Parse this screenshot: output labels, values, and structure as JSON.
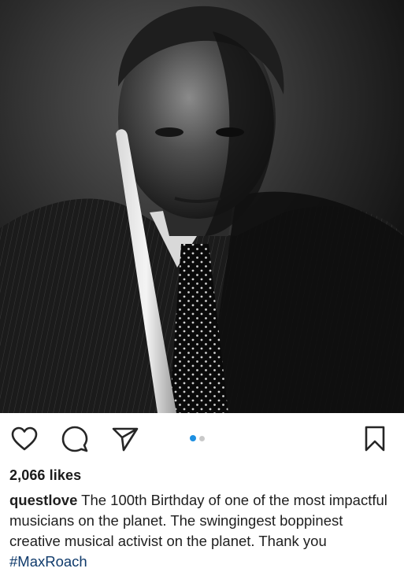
{
  "post": {
    "image_alt": "Black-and-white portrait photograph of a man in a pinstripe suit and polka-dot tie holding a drumstick vertically",
    "likes_text": "2,066 likes",
    "caption": {
      "username": "questlove",
      "text": " The 100th Birthday of one of the most impactful musicians on the planet. The swingingest boppinest creative musical activist on the planet. Thank you ",
      "hashtag": "#MaxRoach"
    },
    "carousel": {
      "count": 2,
      "active_index": 0
    }
  },
  "actions": {
    "icons": [
      "heart-icon",
      "comment-icon",
      "share-icon",
      "bookmark-icon"
    ]
  },
  "colors": {
    "active_dot": "#1d8fe1",
    "inactive_dot": "#c9c9c9",
    "hashtag": "#0f3a6b",
    "icon": "#262626"
  }
}
